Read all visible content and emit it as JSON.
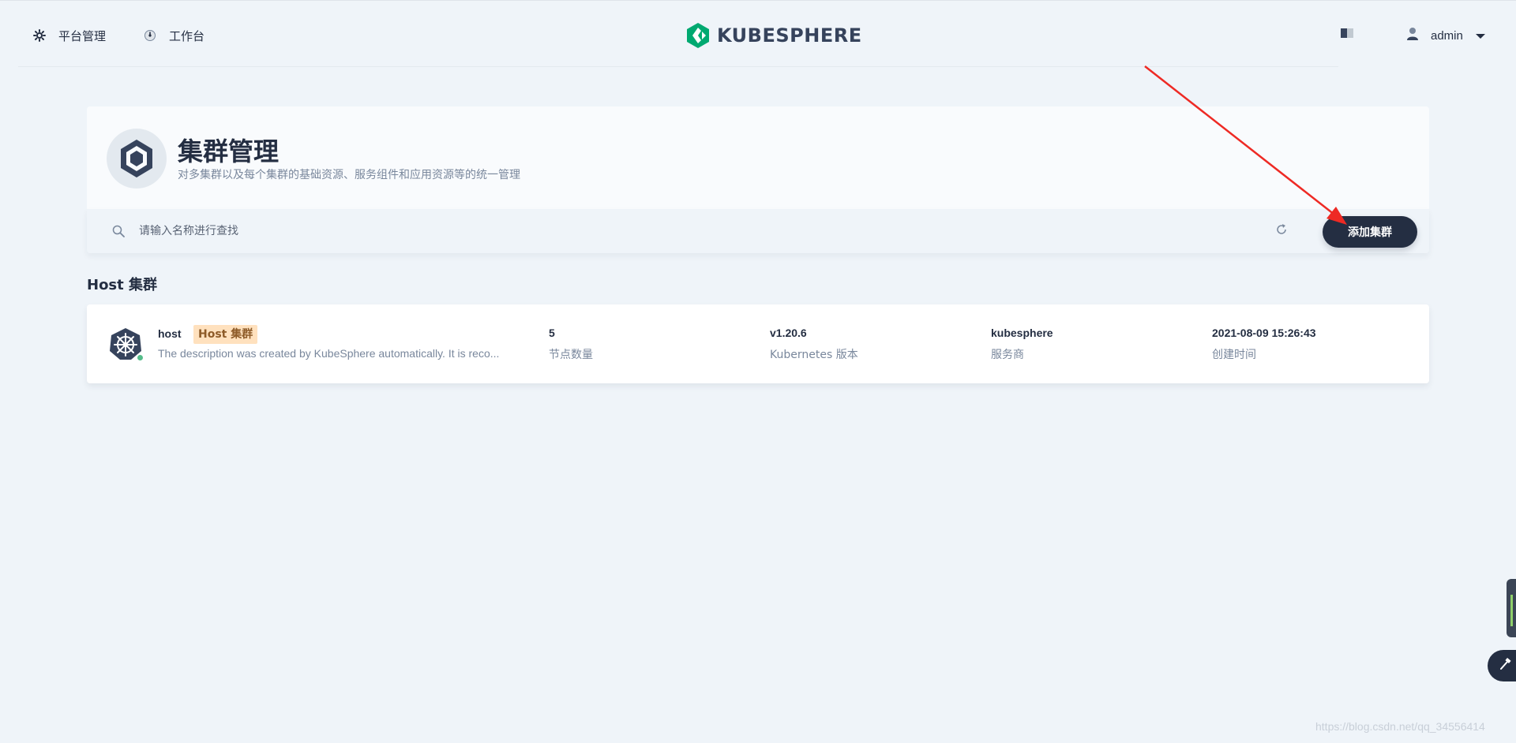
{
  "nav": {
    "platform_label": "平台管理",
    "workbench_label": "工作台",
    "logo_text": "KUBESPHERE",
    "user_name": "admin"
  },
  "header": {
    "title": "集群管理",
    "description": "对多集群以及每个集群的基础资源、服务组件和应用资源等的统一管理"
  },
  "toolbar": {
    "search_placeholder": "请输入名称进行查找",
    "add_button": "添加集群"
  },
  "section_title": "Host 集群",
  "cluster": {
    "name": "host",
    "tag": "Host 集群",
    "description": "The description was created by KubeSphere automatically. It is reco...",
    "status_color": "#55bc8a",
    "stats": [
      {
        "value": "5",
        "label": "节点数量"
      },
      {
        "value": "v1.20.6",
        "label": "Kubernetes 版本"
      },
      {
        "value": "kubesphere",
        "label": "服务商"
      },
      {
        "value": "2021-08-09 15:26:43",
        "label": "创建时间"
      }
    ]
  },
  "watermark": "https://blog.csdn.net/qq_34556414",
  "colors": {
    "accent_dark": "#242e42",
    "brand_green": "#00a971",
    "annotation_arrow": "#ee2a24"
  }
}
